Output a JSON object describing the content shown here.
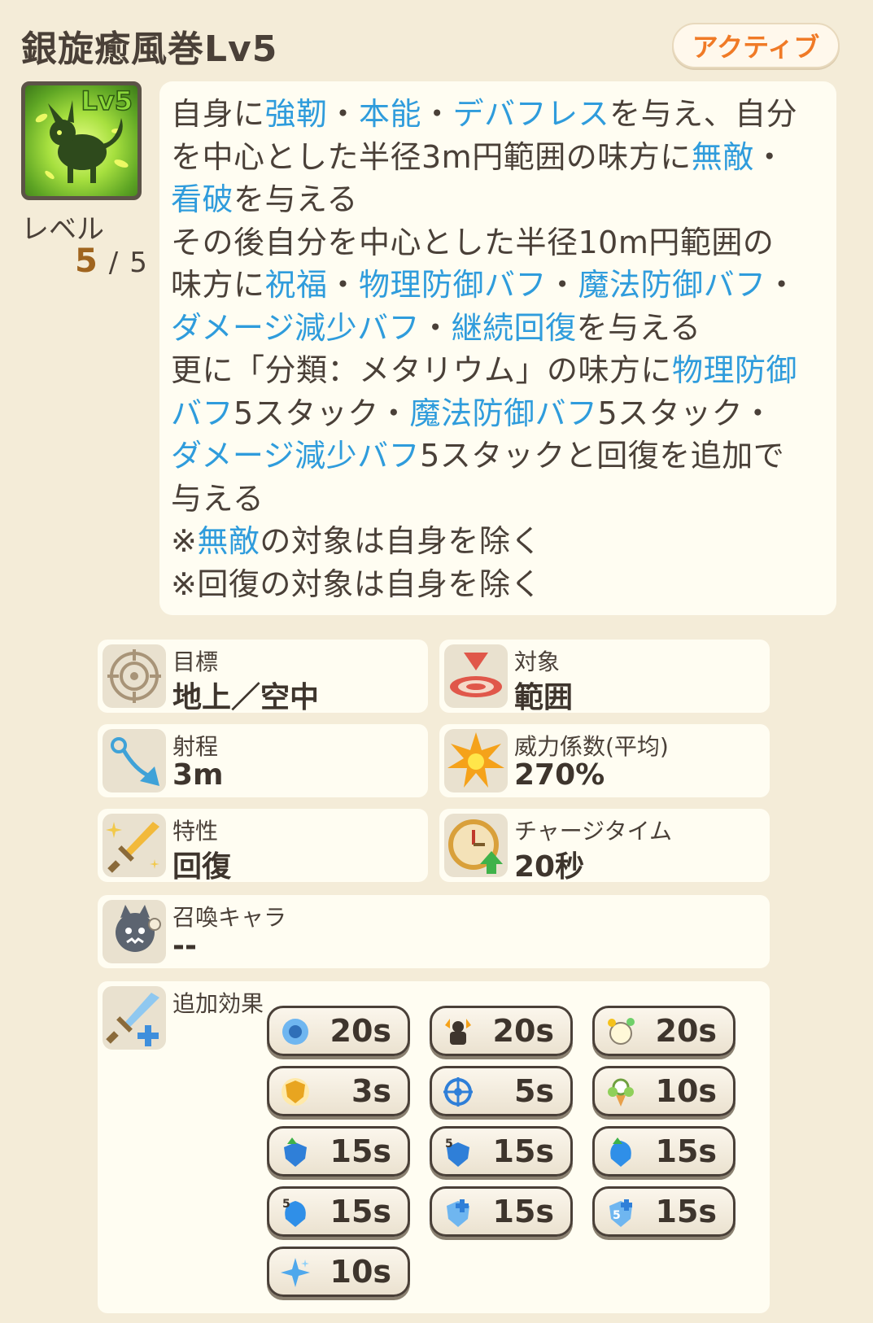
{
  "header": {
    "title": "銀旋癒風巻Lv5",
    "badge": "アクティブ"
  },
  "skill": {
    "icon_level": "Lv5",
    "level_label": "レベル",
    "level_current": "5",
    "level_separator": "/",
    "level_max": "5"
  },
  "description": {
    "lines": [
      [
        {
          "t": "自身に",
          "h": false
        },
        {
          "t": "強靭",
          "h": true
        },
        {
          "t": "・",
          "h": false
        },
        {
          "t": "本能",
          "h": true
        },
        {
          "t": "・",
          "h": false
        },
        {
          "t": "デバフレス",
          "h": true
        },
        {
          "t": "を与え、自分",
          "h": false
        }
      ],
      [
        {
          "t": "を中心とした半径3m円範囲の味方に",
          "h": false
        },
        {
          "t": "無敵",
          "h": true
        },
        {
          "t": "・",
          "h": false
        }
      ],
      [
        {
          "t": "看破",
          "h": true
        },
        {
          "t": "を与える",
          "h": false
        }
      ],
      [
        {
          "t": "その後自分を中心とした半径10m円範囲の",
          "h": false
        }
      ],
      [
        {
          "t": "味方に",
          "h": false
        },
        {
          "t": "祝福",
          "h": true
        },
        {
          "t": "・",
          "h": false
        },
        {
          "t": "物理防御バフ",
          "h": true
        },
        {
          "t": "・",
          "h": false
        },
        {
          "t": "魔法防御バフ",
          "h": true
        },
        {
          "t": "・",
          "h": false
        }
      ],
      [
        {
          "t": "ダメージ減少バフ",
          "h": true
        },
        {
          "t": "・",
          "h": false
        },
        {
          "t": "継続回復",
          "h": true
        },
        {
          "t": "を与える",
          "h": false
        }
      ],
      [
        {
          "t": "更に「分類：メタリウム」の味方に",
          "h": false
        },
        {
          "t": "物理防御",
          "h": true
        }
      ],
      [
        {
          "t": "バフ",
          "h": true
        },
        {
          "t": "5スタック・",
          "h": false
        },
        {
          "t": "魔法防御バフ",
          "h": true
        },
        {
          "t": "5スタック・",
          "h": false
        }
      ],
      [
        {
          "t": "ダメージ減少バフ",
          "h": true
        },
        {
          "t": "5スタックと回復を追加で",
          "h": false
        }
      ],
      [
        {
          "t": "与える",
          "h": false
        }
      ],
      [
        {
          "t": "※",
          "h": false
        },
        {
          "t": "無敵",
          "h": true
        },
        {
          "t": "の対象は自身を除く",
          "h": false
        }
      ],
      [
        {
          "t": "※回復の対象は自身を除く",
          "h": false
        }
      ]
    ]
  },
  "stats": {
    "target": {
      "label": "目標",
      "value": "地上／空中"
    },
    "scope": {
      "label": "対象",
      "value": "範囲"
    },
    "range": {
      "label": "射程",
      "value": "3m"
    },
    "power": {
      "label": "威力係数(平均)",
      "value": "270%"
    },
    "trait": {
      "label": "特性",
      "value": "回復"
    },
    "charge": {
      "label": "チャージタイム",
      "value": "20秒"
    },
    "summon": {
      "label": "召喚キャラ",
      "value": "--"
    }
  },
  "effects": {
    "label": "追加効果",
    "items": [
      {
        "icon": "toughness-icon",
        "value": "20s"
      },
      {
        "icon": "instinct-icon",
        "value": "20s"
      },
      {
        "icon": "debuffless-icon",
        "value": "20s"
      },
      {
        "icon": "invincible-icon",
        "value": "3s"
      },
      {
        "icon": "insight-icon",
        "value": "5s"
      },
      {
        "icon": "blessing-icon",
        "value": "10s"
      },
      {
        "icon": "physical-defense-buff-icon",
        "value": "15s"
      },
      {
        "icon": "physical-defense-buff-5stack-icon",
        "value": "15s"
      },
      {
        "icon": "magic-defense-buff-icon",
        "value": "15s"
      },
      {
        "icon": "magic-defense-buff-5stack-icon",
        "value": "15s"
      },
      {
        "icon": "damage-reduction-buff-icon",
        "value": "15s"
      },
      {
        "icon": "damage-reduction-buff-5stack-icon",
        "value": "15s"
      },
      {
        "icon": "regeneration-icon",
        "value": "10s"
      }
    ]
  }
}
